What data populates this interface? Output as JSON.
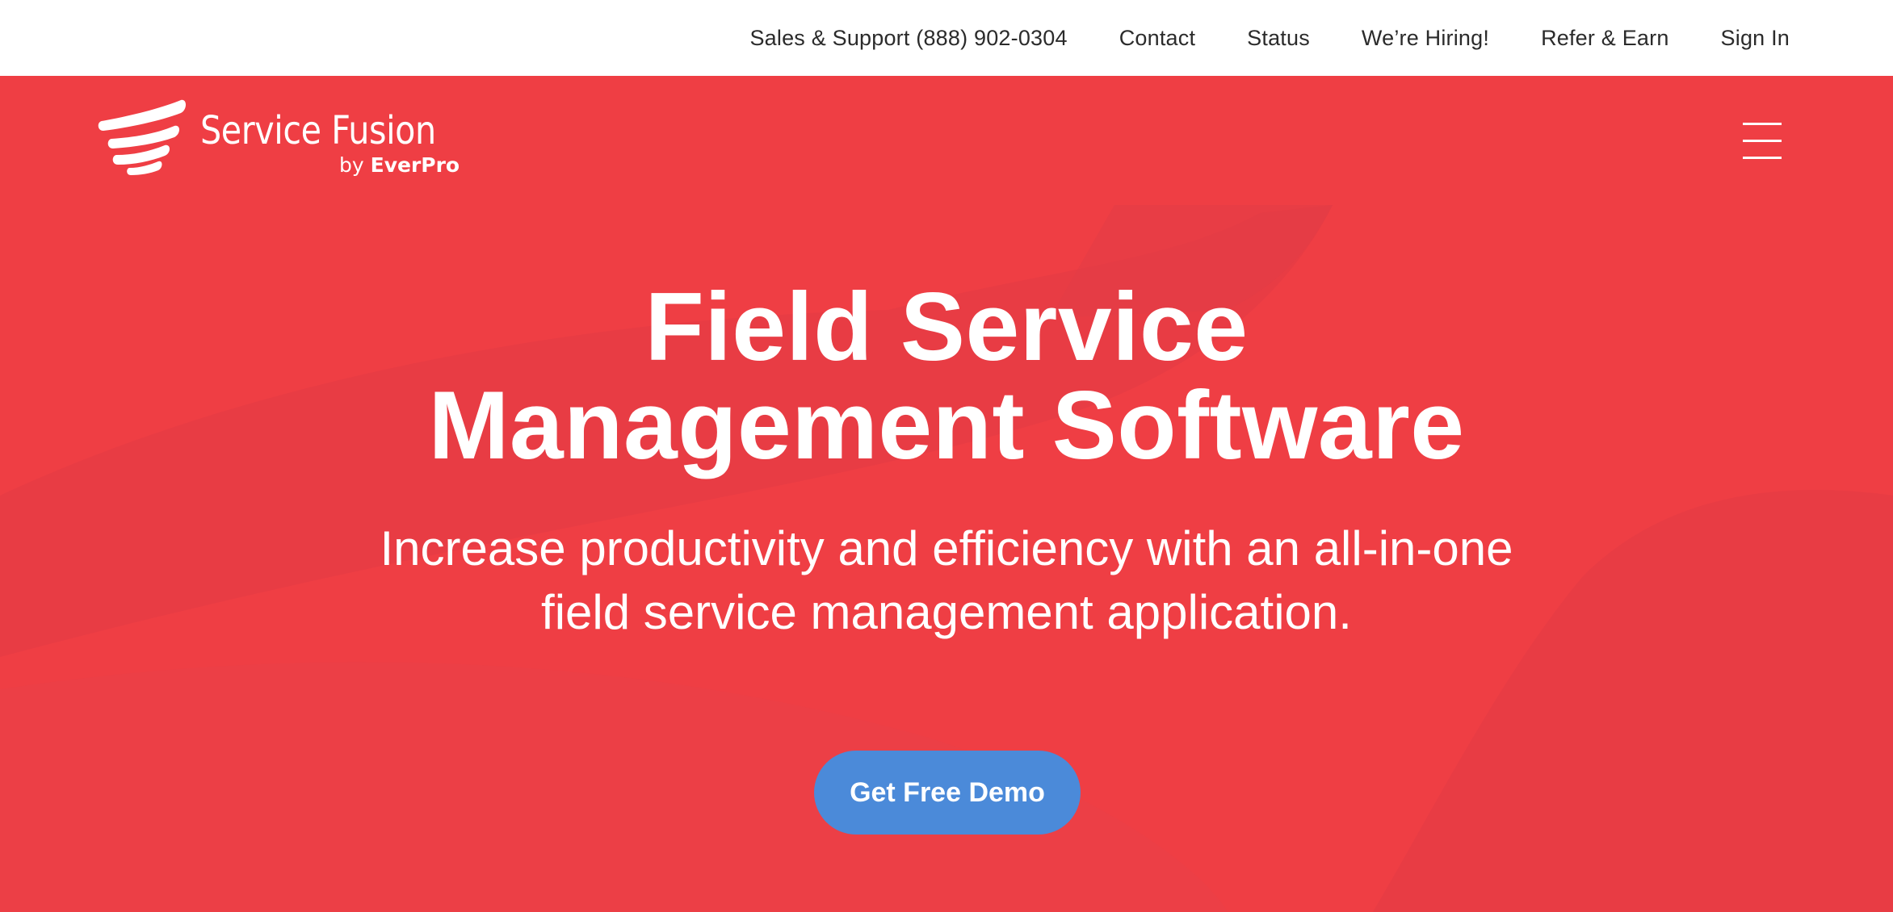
{
  "topnav": {
    "links": [
      {
        "label": "Sales & Support (888) 902-0304"
      },
      {
        "label": "Contact"
      },
      {
        "label": "Status"
      },
      {
        "label": "We’re Hiring!"
      },
      {
        "label": "Refer & Earn"
      },
      {
        "label": "Sign In"
      }
    ]
  },
  "logo": {
    "name": "Service Fusion",
    "by": "by",
    "brand": "EverPro"
  },
  "header": {
    "menu_icon": "hamburger-menu-icon"
  },
  "hero": {
    "headline_line1": "Field Service",
    "headline_line2": "Management Software",
    "subheadline": "Increase productivity and efficiency with an all-in-one field service management application.",
    "cta_label": "Get Free Demo"
  },
  "colors": {
    "hero_background": "#ef3e44",
    "cta_background": "#4b8ad9",
    "topbar_background": "#ffffff",
    "topnav_text": "#2b2b2b"
  }
}
